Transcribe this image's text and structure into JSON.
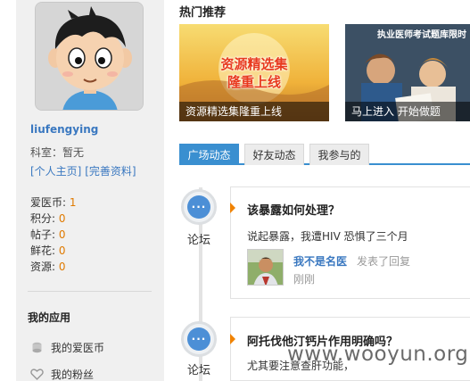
{
  "profile": {
    "username": "liufengying",
    "dept": "科室：暂无",
    "link_home": "[个人主页]",
    "link_edit": "[完善资料]",
    "stats": [
      {
        "label": "爱医币:",
        "value": "1"
      },
      {
        "label": "积分:",
        "value": "0"
      },
      {
        "label": "帖子:",
        "value": "0"
      },
      {
        "label": "鲜花:",
        "value": "0"
      },
      {
        "label": "资源:",
        "value": "0"
      }
    ]
  },
  "apps": {
    "title": "我的应用",
    "items": [
      {
        "label": "我的爱医币",
        "icon": "coins-icon"
      },
      {
        "label": "我的粉丝",
        "icon": "heart-icon"
      }
    ]
  },
  "hot": {
    "title": "热门推荐",
    "banners": [
      {
        "overlay_line1": "资源精选集",
        "overlay_line2": "隆重上线",
        "caption": "资源精选集隆重上线"
      },
      {
        "overlay_top": "执业医师考试题库限时",
        "caption": "马上进入 开始做题"
      }
    ]
  },
  "tabs": [
    {
      "label": "广场动态",
      "active": true
    },
    {
      "label": "好友动态",
      "active": false
    },
    {
      "label": "我参与的",
      "active": false
    }
  ],
  "feed": [
    {
      "category": "论坛",
      "bubble_text": "···",
      "title": "该暴露如何处理？",
      "body": "说起暴露，我遭HIV 恐惧了三个月",
      "user": "我不是名医",
      "action": "发表了回复",
      "time": "刚刚"
    },
    {
      "category": "论坛",
      "bubble_text": "···",
      "title": "阿托伐他汀钙片作用明确吗？",
      "body": "尤其要注意查肝功能，"
    }
  ],
  "watermark": "www.wooyun.org",
  "colors": {
    "accent": "#3a8fd0",
    "link": "#3a78c0",
    "orange": "#f08200",
    "stat_value": "#e07a00"
  }
}
